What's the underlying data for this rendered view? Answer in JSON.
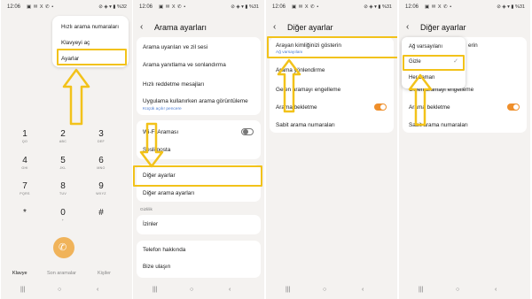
{
  "common": {
    "status_time": "12:06",
    "status_icons_left": "▣ ✉ X ✆ •",
    "status_right_1": "⊘ ◈ ▾ ▮ %32",
    "status_right": "⊘ ◈ ▾ ▮ %31",
    "nav_recents": "|||",
    "nav_home": "○",
    "nav_back": "‹",
    "back_glyph": "‹"
  },
  "dialer": {
    "menu": [
      "Hızlı arama numaraları",
      "Klavyeyi aç",
      "Ayarlar"
    ],
    "keys": [
      {
        "digit": "1",
        "sub": "QO"
      },
      {
        "digit": "2",
        "sub": "ABC"
      },
      {
        "digit": "3",
        "sub": "DEF"
      },
      {
        "digit": "4",
        "sub": "GHI"
      },
      {
        "digit": "5",
        "sub": "JKL"
      },
      {
        "digit": "6",
        "sub": "MNO"
      },
      {
        "digit": "7",
        "sub": "PQRS"
      },
      {
        "digit": "8",
        "sub": "TUV"
      },
      {
        "digit": "9",
        "sub": "WXYZ"
      },
      {
        "digit": "*",
        "sub": ""
      },
      {
        "digit": "0",
        "sub": "+"
      },
      {
        "digit": "#",
        "sub": ""
      }
    ],
    "tabs": [
      "Klavye",
      "Son aramalar",
      "Kişiler"
    ]
  },
  "call_settings": {
    "title": "Arama ayarları",
    "items": [
      "Arama uyarıları ve zil sesi",
      "Arama yanıtlama ve sonlandırma",
      "Hızlı reddetme mesajları",
      "Uygulama kullanırken arama görüntüleme",
      "Wi-Fi Araması",
      "Sesli posta",
      "Diğer ayarlar",
      "Diğer arama ayarları",
      "İzinler",
      "Telefon hakkında",
      "Bize ulaşın"
    ],
    "app_sub": "Küçük açılır pencere",
    "section_label": "Gizlilik",
    "wifi_calling": false
  },
  "other_settings": {
    "title": "Diğer ayarlar",
    "items": [
      "Arayan kimliğinizi gösterin",
      "Arama yönlendirme",
      "Gelen aramayı engelleme",
      "Arama bekletme",
      "Sabit arama numaraları"
    ],
    "caller_id_value": "Ağ varsayılanı",
    "call_waiting": true
  },
  "caller_id_popup": {
    "title": "Diğer ayarlar",
    "options": [
      "Ağ varsayılanı",
      "Gizle",
      "Her zaman"
    ],
    "selected": "Gizle",
    "peek_items": [
      "erin",
      "Gelen aramayı engelleme",
      "Arama bekletme",
      "Sabit arama numaraları"
    ],
    "call_waiting": true
  },
  "colors": {
    "highlight": "#f2c21a",
    "accent": "#ef8f2b",
    "link": "#4a7bd0"
  }
}
